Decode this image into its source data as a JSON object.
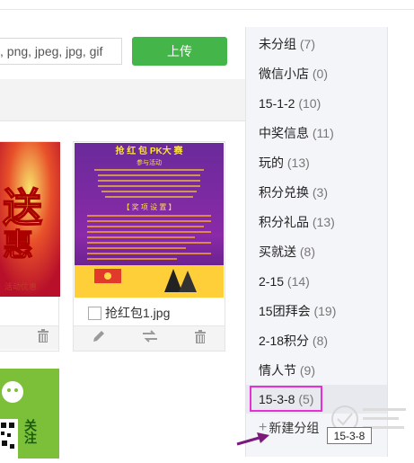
{
  "upload": {
    "file_types_text": ", png, jpeg, jpg, gif",
    "button_label": "上传"
  },
  "images": [
    {
      "name": "",
      "poster_text": [
        "送",
        "惠",
        "活动优惠"
      ]
    },
    {
      "name": "抢红包1.jpg",
      "poster_text": {
        "title": "抢 红 包 PK大 赛",
        "subtitle": "参与活动",
        "section": "【 奖 项 设 置 】"
      }
    }
  ],
  "third_card": {
    "label_text": "关注"
  },
  "groups": [
    {
      "name": "未分组",
      "count": "(7)"
    },
    {
      "name": "微信小店",
      "count": "(0)"
    },
    {
      "name": "15-1-2",
      "count": "(10)"
    },
    {
      "name": "中奖信息",
      "count": "(11)"
    },
    {
      "name": "玩的",
      "count": "(13)"
    },
    {
      "name": "积分兑换",
      "count": "(3)"
    },
    {
      "name": "积分礼品",
      "count": "(13)"
    },
    {
      "name": "买就送",
      "count": "(8)"
    },
    {
      "name": "2-15",
      "count": "(14)"
    },
    {
      "name": "15团拜会",
      "count": "(19)"
    },
    {
      "name": "2-18积分",
      "count": "(8)"
    },
    {
      "name": "情人节",
      "count": "(9)"
    },
    {
      "name": "15-3-8",
      "count": "(5)"
    }
  ],
  "new_group_label": "新建分组",
  "tooltip_text": "15-3-8",
  "colors": {
    "upload_green": "#44b549",
    "highlight": "#e62fd8",
    "arrow": "#7a1a7a"
  }
}
